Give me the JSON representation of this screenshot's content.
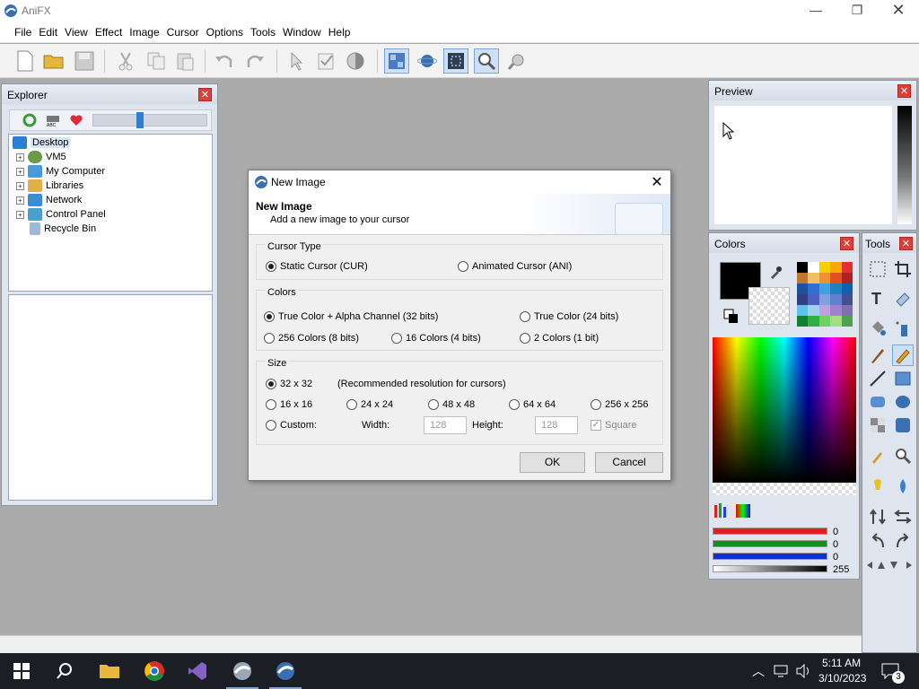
{
  "app": {
    "title": "AniFX"
  },
  "menu": [
    "File",
    "Edit",
    "View",
    "Effect",
    "Image",
    "Cursor",
    "Options",
    "Tools",
    "Window",
    "Help"
  ],
  "explorer": {
    "title": "Explorer",
    "tree": [
      {
        "label": "Desktop",
        "selected": true
      },
      {
        "label": "VM5"
      },
      {
        "label": "My Computer"
      },
      {
        "label": "Libraries"
      },
      {
        "label": "Network"
      },
      {
        "label": "Control Panel"
      },
      {
        "label": "Recycle Bin"
      }
    ]
  },
  "preview": {
    "title": "Preview"
  },
  "colors": {
    "title": "Colors",
    "red": "0",
    "green": "0",
    "blue": "0",
    "alpha": "255"
  },
  "tools": {
    "title": "Tools"
  },
  "dialog": {
    "title": "New Image",
    "header_title": "New Image",
    "header_sub": "Add a new image to your cursor",
    "cursor_type": {
      "label": "Cursor Type",
      "static": "Static Cursor (CUR)",
      "animated": "Animated Cursor (ANI)"
    },
    "colors": {
      "label": "Colors",
      "c32": "True Color + Alpha Channel (32 bits)",
      "c24": "True Color (24 bits)",
      "c8": "256 Colors (8 bits)",
      "c4": "16 Colors (4 bits)",
      "c1": "2 Colors (1 bit)"
    },
    "size": {
      "label": "Size",
      "s32": "32 x 32",
      "recommended": "(Recommended resolution for cursors)",
      "s16": "16 x 16",
      "s24": "24 x 24",
      "s48": "48 x 48",
      "s64": "64 x 64",
      "s256": "256 x 256",
      "custom": "Custom:",
      "width_label": "Width:",
      "width_value": "128",
      "height_label": "Height:",
      "height_value": "128",
      "square": "Square"
    },
    "ok": "OK",
    "cancel": "Cancel"
  },
  "taskbar": {
    "time": "5:11 AM",
    "date": "3/10/2023",
    "notif": "3"
  }
}
